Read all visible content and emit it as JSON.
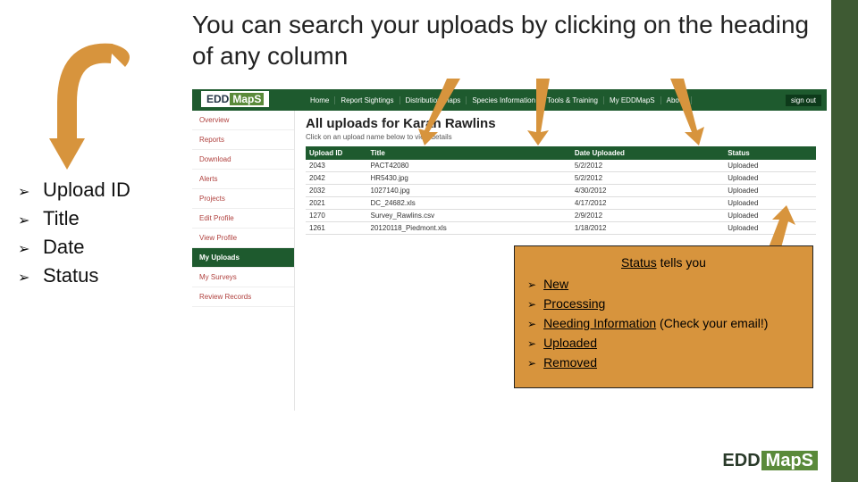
{
  "heading": "You can search your uploads by clicking on the heading of any column",
  "left_list": {
    "items": [
      "Upload ID",
      "Title",
      "Date",
      "Status"
    ]
  },
  "screenshot": {
    "logo_prefix": "EDD",
    "logo_maps": "MapS",
    "nav": [
      "Home",
      "Report Sightings",
      "Distribution Maps",
      "Species Information",
      "Tools & Training",
      "My EDDMapS",
      "About"
    ],
    "signout": "sign out",
    "sidebar": {
      "items": [
        "Overview",
        "Reports",
        "Download",
        "Alerts",
        "Projects",
        "Edit Profile",
        "View Profile",
        "My Uploads",
        "My Surveys",
        "Review Records"
      ],
      "active_index": 7
    },
    "page_title": "All uploads for Karan Rawlins",
    "page_sub": "Click on an upload name below to view details",
    "columns": [
      "Upload ID",
      "Title",
      "Date Uploaded",
      "Status"
    ],
    "rows": [
      {
        "id": "2043",
        "title": "PACT42080",
        "date": "5/2/2012",
        "status": "Uploaded"
      },
      {
        "id": "2042",
        "title": "HR5430.jpg",
        "date": "5/2/2012",
        "status": "Uploaded"
      },
      {
        "id": "2032",
        "title": "1027140.jpg",
        "date": "4/30/2012",
        "status": "Uploaded"
      },
      {
        "id": "2021",
        "title": "DC_24682.xls",
        "date": "4/17/2012",
        "status": "Uploaded"
      },
      {
        "id": "1270",
        "title": "Survey_Rawlins.csv",
        "date": "2/9/2012",
        "status": "Uploaded"
      },
      {
        "id": "1261",
        "title": "20120118_Piedmont.xls",
        "date": "1/18/2012",
        "status": "Uploaded"
      }
    ]
  },
  "status_box": {
    "title_u": "Status",
    "title_rest": " tells you",
    "items": [
      "New",
      "Processing",
      "Needing Information",
      "Uploaded",
      "Removed"
    ],
    "needing_suffix": " (Check your email!)"
  },
  "footer": {
    "prefix": "EDD",
    "maps": "MapS"
  }
}
